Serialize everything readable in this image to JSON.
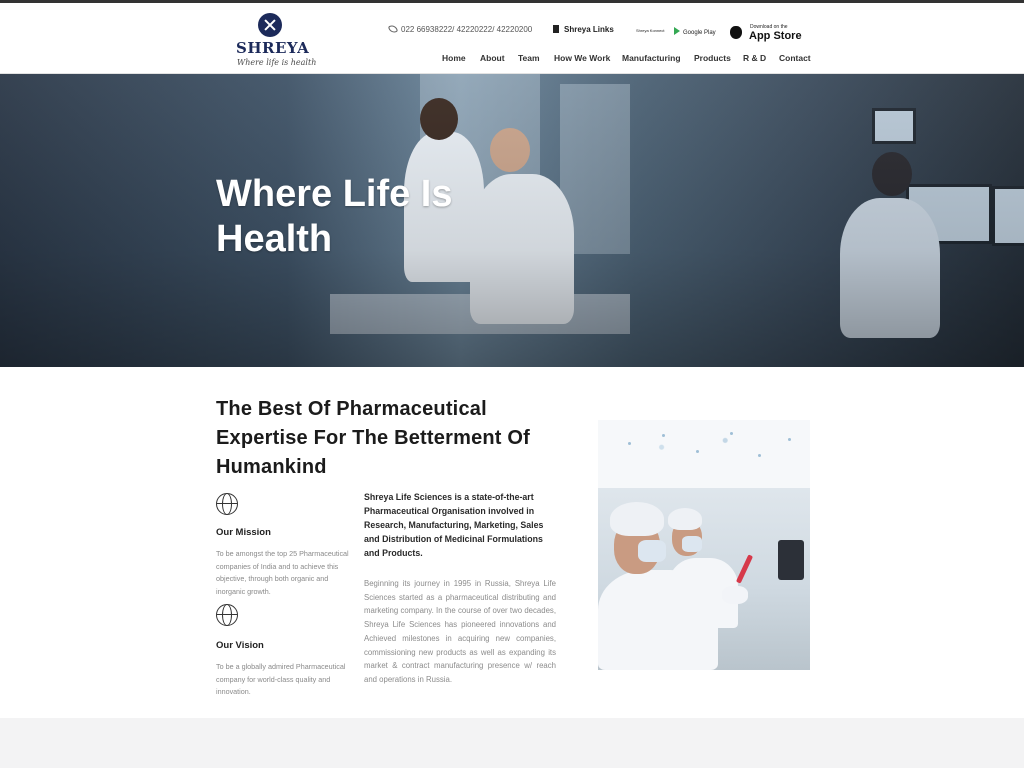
{
  "brand": {
    "name": "SHREYA",
    "tagline": "Where life is health"
  },
  "topbar": {
    "phone": "022 66938222/ 42220222/ 42220200",
    "links_label": "Shreya Links",
    "konnect_label": "Shreya Konnect",
    "google_play_label": "Google Play",
    "app_store_small": "Download on the",
    "app_store_label": "App Store"
  },
  "nav": {
    "items": [
      "Home",
      "About",
      "Team",
      "How We Work",
      "Manufacturing",
      "Products",
      "R & D",
      "Contact"
    ],
    "active": "Home"
  },
  "hero": {
    "title": "Where Life Is Health"
  },
  "main": {
    "headline": "The Best Of Pharmaceutical Expertise For The Betterment Of Humankind",
    "mission": {
      "title": "Our Mission",
      "text": "To be amongst the top 25 Pharmaceutical companies of India and to achieve this objective, through both organic and inorganic growth."
    },
    "vision": {
      "title": "Our Vision",
      "text": "To be a globally admired Pharmaceutical company for world-class quality and innovation."
    },
    "intro": "Shreya Life Sciences is a state-of-the-art Pharmaceutical Organisation involved in Research, Manufacturing, Marketing, Sales and Distribution of Medicinal Formulations and Products.",
    "body": "Beginning its journey in 1995 in Russia, Shreya Life Sciences started as a pharmaceutical distributing and marketing company. In the course of over two decades, Shreya Life Sciences has pioneered innovations and Achieved milestones in acquiring new companies, commissioning new products as well as expanding its market & contract manufacturing presence w/ reach and operations in Russia."
  },
  "icons": {
    "logo": "shreya-logo-icon",
    "phone": "phone-icon",
    "links": "document-icon",
    "google_play": "google-play-icon",
    "apple": "apple-icon",
    "mission": "globe-icon",
    "vision": "globe-icon"
  },
  "colors": {
    "brand_navy": "#1c2a5a",
    "text_dark": "#1b1b1b",
    "text_muted": "#8a8a8a"
  }
}
